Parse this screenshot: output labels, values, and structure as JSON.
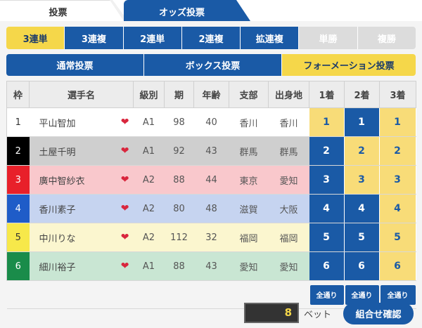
{
  "tabs": {
    "vote": "投票",
    "odds": "オッズ投票"
  },
  "bet_types": [
    {
      "label": "3連単",
      "state": "active"
    },
    {
      "label": "3連複",
      "state": "normal"
    },
    {
      "label": "2連単",
      "state": "normal"
    },
    {
      "label": "2連複",
      "state": "normal"
    },
    {
      "label": "拡連複",
      "state": "normal"
    },
    {
      "label": "単勝",
      "state": "disabled"
    },
    {
      "label": "複勝",
      "state": "disabled"
    }
  ],
  "methods": [
    {
      "label": "通常投票",
      "state": "normal"
    },
    {
      "label": "ボックス投票",
      "state": "normal"
    },
    {
      "label": "フォーメーション投票",
      "state": "active"
    }
  ],
  "table": {
    "headers": [
      "枠",
      "選手名",
      "級別",
      "期",
      "年齢",
      "支部",
      "出身地",
      "1着",
      "2着",
      "3着"
    ],
    "rows": [
      {
        "frame": "1",
        "name": "平山智加",
        "grade": "A1",
        "term": "98",
        "age": "40",
        "branch": "香川",
        "origin": "香川",
        "picks": [
          "1",
          "1",
          "1"
        ],
        "selected": [
          false,
          true,
          false
        ]
      },
      {
        "frame": "2",
        "name": "土屋千明",
        "grade": "A1",
        "term": "92",
        "age": "43",
        "branch": "群馬",
        "origin": "群馬",
        "picks": [
          "2",
          "2",
          "2"
        ],
        "selected": [
          true,
          false,
          false
        ]
      },
      {
        "frame": "3",
        "name": "廣中智紗衣",
        "grade": "A2",
        "term": "88",
        "age": "44",
        "branch": "東京",
        "origin": "愛知",
        "picks": [
          "3",
          "3",
          "3"
        ],
        "selected": [
          true,
          false,
          false
        ]
      },
      {
        "frame": "4",
        "name": "香川素子",
        "grade": "A2",
        "term": "80",
        "age": "48",
        "branch": "滋賀",
        "origin": "大阪",
        "picks": [
          "4",
          "4",
          "4"
        ],
        "selected": [
          true,
          true,
          false
        ]
      },
      {
        "frame": "5",
        "name": "中川りな",
        "grade": "A2",
        "term": "112",
        "age": "32",
        "branch": "福岡",
        "origin": "福岡",
        "picks": [
          "5",
          "5",
          "5"
        ],
        "selected": [
          true,
          true,
          false
        ]
      },
      {
        "frame": "6",
        "name": "細川裕子",
        "grade": "A1",
        "term": "88",
        "age": "43",
        "branch": "愛知",
        "origin": "愛知",
        "picks": [
          "6",
          "6",
          "6"
        ],
        "selected": [
          true,
          true,
          false
        ]
      }
    ],
    "all_label": "全通り"
  },
  "frame_colors": [
    "#ffffff",
    "#000000",
    "#e8202a",
    "#1f5cc8",
    "#f7e84a",
    "#1a8c4a"
  ],
  "frame_text_colors": [
    "#333333",
    "#ffffff",
    "#ffffff",
    "#ffffff",
    "#333333",
    "#ffffff"
  ],
  "row_colors": [
    "#ffffff",
    "#cfcfcf",
    "#f9c8cc",
    "#c6d4f0",
    "#fbf6cf",
    "#c9e6d3"
  ],
  "footer": {
    "count": "8",
    "unit": "ベット",
    "confirm": "組合せ確認"
  }
}
